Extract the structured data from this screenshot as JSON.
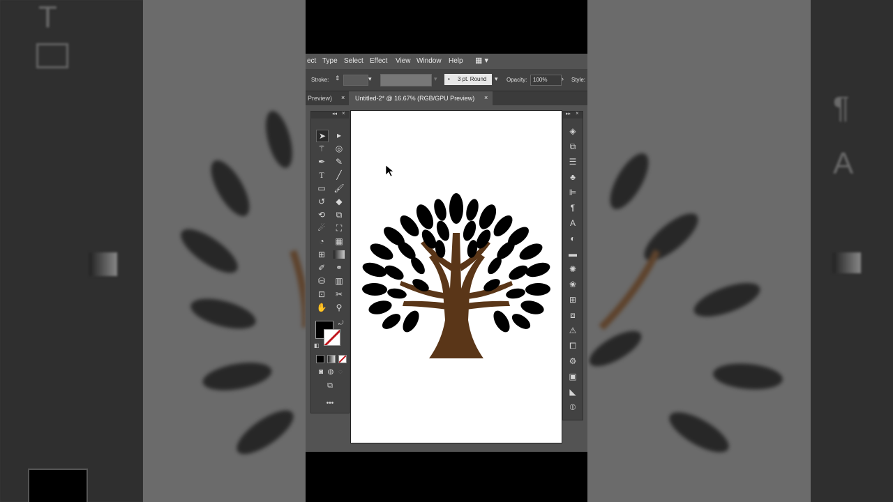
{
  "menu": {
    "items": [
      "ect",
      "Type",
      "Select",
      "Effect",
      "View",
      "Window",
      "Help"
    ]
  },
  "control_bar": {
    "stroke_label": "Stroke:",
    "profile_value": "3 pt. Round",
    "opacity_label": "Opacity:",
    "opacity_value": "100%",
    "style_label": "Style:"
  },
  "tabs": {
    "prev_tab": "Preview)",
    "active_tab": "Untitled-2* @ 16.67% (RGB/GPU Preview)",
    "close_glyph": "×"
  },
  "colors": {
    "trunk": "#5a3618",
    "leaf": "#000000",
    "ui_dark": "#424242",
    "ui_mid": "#535353"
  },
  "ghost_text": {
    "type_tool": "T",
    "char_panel": "A",
    "para_panel": "¶"
  },
  "icons": {
    "selection": "selection-arrow-icon",
    "direct_selection": "direct-selection-icon",
    "hand": "hand-icon",
    "zoom": "zoom-icon"
  }
}
